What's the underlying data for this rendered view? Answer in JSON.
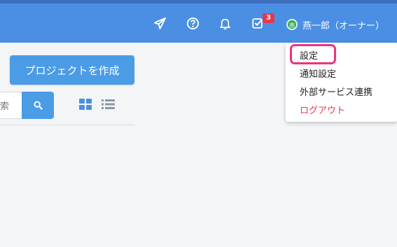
{
  "header": {
    "notification_badge": "3",
    "user": {
      "avatar_text": "燕",
      "name": "燕一郎（オーナー）"
    }
  },
  "dropdown": {
    "items": [
      {
        "label": "設定"
      },
      {
        "label": "通知設定"
      },
      {
        "label": "外部サービス連携"
      },
      {
        "label": "ログアウト"
      }
    ]
  },
  "main": {
    "create_button": "プロジェクトを作成",
    "search_partial_text": "索"
  },
  "colors": {
    "header": "#4a8fe3",
    "primary": "#4b9ce7",
    "badge": "#e5374e",
    "highlight": "#f0337d",
    "logout": "#e5374e"
  },
  "icons": [
    "paper-plane-icon",
    "help-circle-icon",
    "bell-icon",
    "checkbox-icon",
    "search-icon",
    "grid-view-icon",
    "list-view-icon"
  ]
}
